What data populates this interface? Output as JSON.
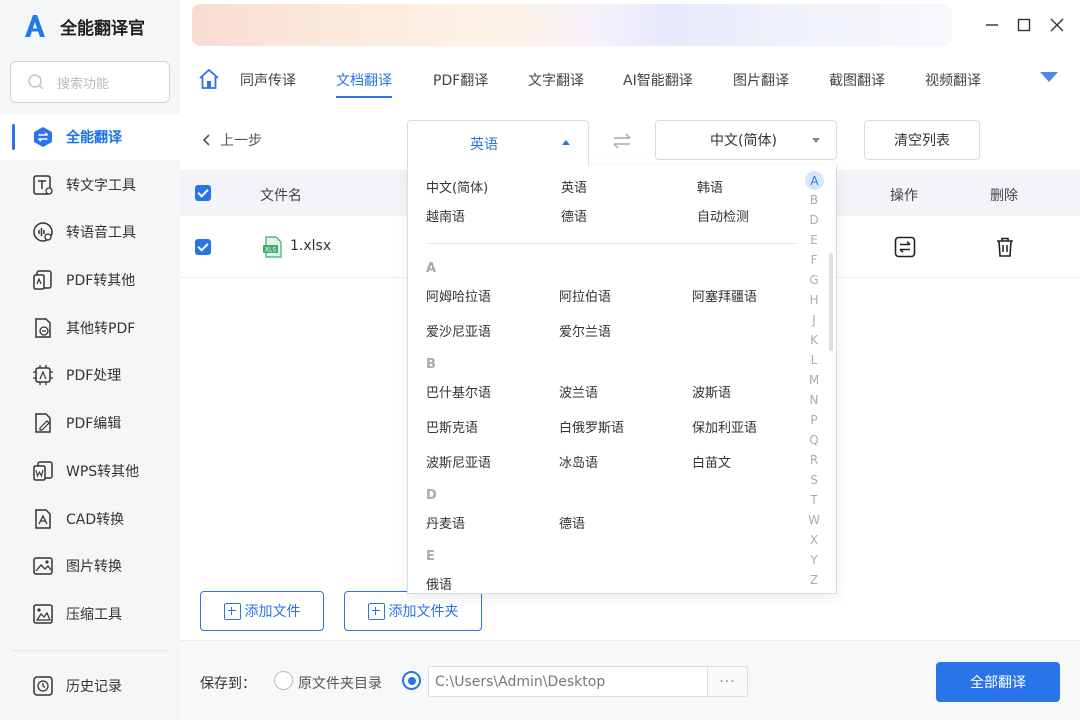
{
  "app": {
    "name": "全能翻译官"
  },
  "search": {
    "placeholder": "搜索功能"
  },
  "sidebar": {
    "items": [
      {
        "label": "全能翻译",
        "active": true
      },
      {
        "label": "转文字工具"
      },
      {
        "label": "转语音工具"
      },
      {
        "label": "PDF转其他"
      },
      {
        "label": "其他转PDF"
      },
      {
        "label": "PDF处理"
      },
      {
        "label": "PDF编辑"
      },
      {
        "label": "WPS转其他"
      },
      {
        "label": "CAD转换"
      },
      {
        "label": "图片转换"
      },
      {
        "label": "压缩工具"
      }
    ],
    "history": "历史记录"
  },
  "tabs": [
    "同声传译",
    "文档翻译",
    "PDF翻译",
    "文字翻译",
    "AI智能翻译",
    "图片翻译",
    "截图翻译",
    "视频翻译"
  ],
  "active_tab": "文档翻译",
  "toolbar": {
    "back": "上一步",
    "source_lang": "英语",
    "target_lang": "中文(简体)",
    "clear": "清空列表"
  },
  "table": {
    "headers": {
      "filename": "文件名",
      "action": "操作",
      "delete": "删除"
    },
    "rows": [
      {
        "file": "1.xlsx",
        "file_icon_text": "XLS"
      }
    ]
  },
  "dropdown": {
    "common": [
      "中文(简体)",
      "英语",
      "韩语",
      "越南语",
      "德语",
      "自动检测"
    ],
    "groups": [
      {
        "letter": "A",
        "langs": [
          "阿姆哈拉语",
          "阿拉伯语",
          "阿塞拜疆语",
          "爱沙尼亚语",
          "爱尔兰语"
        ]
      },
      {
        "letter": "B",
        "langs": [
          "巴什基尔语",
          "波兰语",
          "波斯语",
          "巴斯克语",
          "白俄罗斯语",
          "保加利亚语",
          "波斯尼亚语",
          "冰岛语",
          "白苗文"
        ]
      },
      {
        "letter": "D",
        "langs": [
          "丹麦语",
          "德语"
        ]
      },
      {
        "letter": "E",
        "langs": [
          "俄语"
        ]
      }
    ],
    "alphabet": [
      "A",
      "B",
      "D",
      "E",
      "F",
      "G",
      "H",
      "J",
      "K",
      "L",
      "M",
      "N",
      "P",
      "Q",
      "R",
      "S",
      "T",
      "W",
      "X",
      "Y",
      "Z"
    ]
  },
  "actions": {
    "add_file": "添加文件",
    "add_folder": "添加文件夹"
  },
  "footer": {
    "save_to": "保存到：",
    "original_dir": "原文件夹目录",
    "path": "C:\\Users\\Admin\\Desktop",
    "browse": "···",
    "translate_all": "全部翻译"
  },
  "colors": {
    "accent": "#2a74e9",
    "sidebar_bg": "#f5f6f8",
    "logo": "#1e7ce8"
  }
}
